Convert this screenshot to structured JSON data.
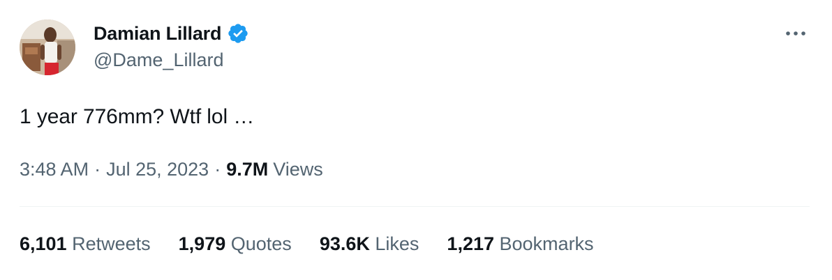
{
  "author": {
    "display_name": "Damian Lillard",
    "handle": "@Dame_Lillard",
    "verified": true,
    "verified_color": "#1d9bf0"
  },
  "tweet": {
    "text": "1 year 776mm? Wtf lol …",
    "time": "3:48 AM",
    "separator": "·",
    "date": "Jul 25, 2023",
    "views_count": "9.7M",
    "views_label": "Views"
  },
  "stats": [
    {
      "count": "6,101",
      "label": "Retweets"
    },
    {
      "count": "1,979",
      "label": "Quotes"
    },
    {
      "count": "93.6K",
      "label": "Likes"
    },
    {
      "count": "1,217",
      "label": "Bookmarks"
    }
  ],
  "icons": {
    "more": "more-horizontal-icon",
    "verified": "verified-badge-icon"
  },
  "colors": {
    "text_primary": "#0f1419",
    "text_secondary": "#536471",
    "divider": "#eff3f4",
    "accent": "#1d9bf0"
  }
}
